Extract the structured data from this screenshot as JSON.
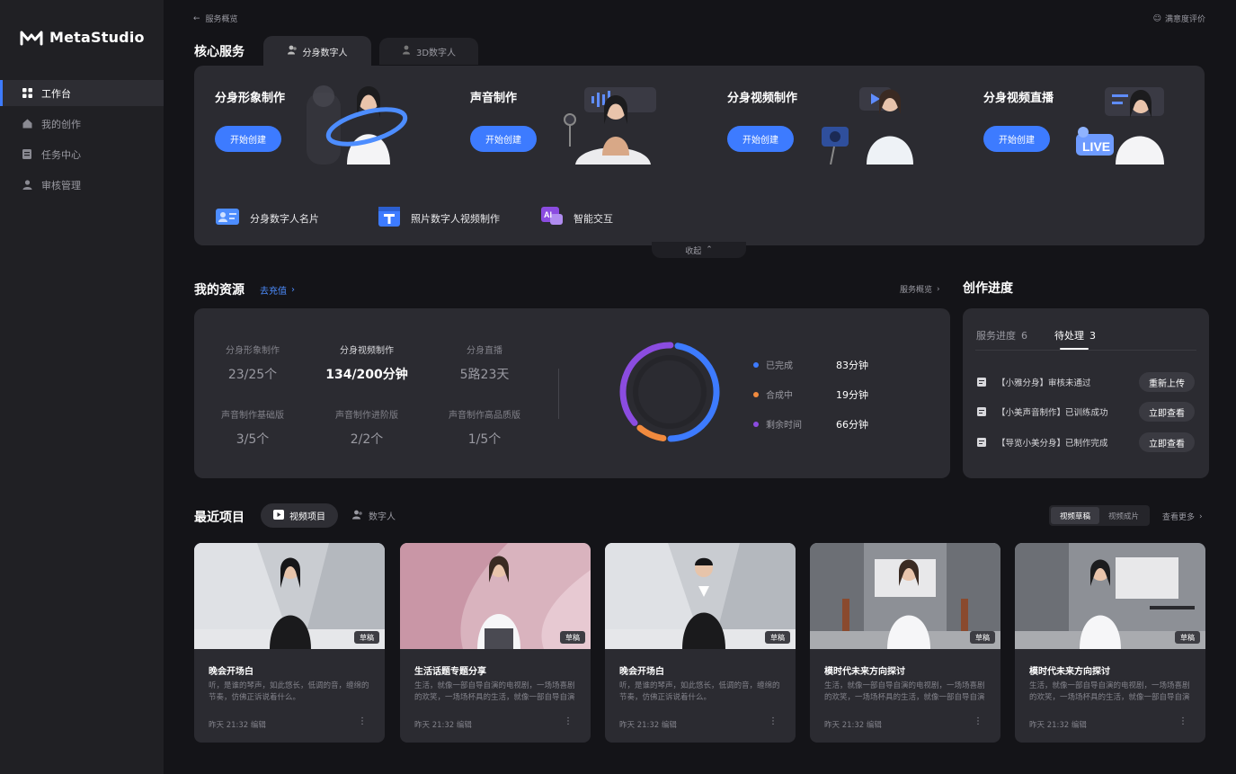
{
  "app": {
    "name": "MetaStudio"
  },
  "sidebar": {
    "items": [
      {
        "label": "工作台",
        "icon": "grid-icon",
        "active": true
      },
      {
        "label": "我的创作",
        "icon": "home-icon"
      },
      {
        "label": "任务中心",
        "icon": "task-icon"
      },
      {
        "label": "审核管理",
        "icon": "user-icon"
      }
    ]
  },
  "topbar": {
    "back_label": "服务概览",
    "feedback_label": "满意度评价"
  },
  "core": {
    "title": "核心服务",
    "tabs": [
      {
        "label": "分身数字人",
        "icon": "avatar-icon"
      },
      {
        "label": "3D数字人",
        "icon": "3d-avatar-icon"
      }
    ],
    "services": [
      {
        "title": "分身形象制作",
        "button": "开始创建"
      },
      {
        "title": "声音制作",
        "button": "开始创建"
      },
      {
        "title": "分身视频制作",
        "button": "开始创建"
      },
      {
        "title": "分身视频直播",
        "button": "开始创建"
      }
    ],
    "live_badge": "LIVE",
    "quick_links": [
      {
        "label": "分身数字人名片",
        "icon": "card-icon"
      },
      {
        "label": "照片数字人视频制作",
        "icon": "photo-video-icon"
      },
      {
        "label": "智能交互",
        "icon": "ai-chat-icon",
        "icon_text": "AI"
      }
    ],
    "collapse_label": "收起"
  },
  "resources": {
    "title": "我的资源",
    "recharge_label": "去充值",
    "overview_label": "服务概览",
    "items": [
      {
        "label": "分身形象制作",
        "value": "23/25个"
      },
      {
        "label": "分身视频制作",
        "value": "134/200分钟"
      },
      {
        "label": "分身直播",
        "value": "5路23天"
      },
      {
        "label": "声音制作基础版",
        "value": "3/5个"
      },
      {
        "label": "声音制作进阶版",
        "value": "2/2个"
      },
      {
        "label": "声音制作高品质版",
        "value": "1/5个"
      }
    ],
    "usage": [
      {
        "label": "已完成",
        "value": "83分钟",
        "minutes": 83,
        "color": "#3d7bff"
      },
      {
        "label": "合成中",
        "value": "19分钟",
        "minutes": 19,
        "color": "#f08a3e"
      },
      {
        "label": "剩余时间",
        "value": "66分钟",
        "minutes": 66,
        "color": "#8b4ce0"
      }
    ]
  },
  "progress": {
    "title": "创作进度",
    "tabs": [
      {
        "label": "服务进度",
        "count": "6"
      },
      {
        "label": "待处理",
        "count": "3",
        "active": true
      }
    ],
    "tasks": [
      {
        "text": "【小雅分身】审核未通过",
        "button": "重新上传"
      },
      {
        "text": "【小美声音制作】已训练成功",
        "button": "立即查看"
      },
      {
        "text": "【导览小美分身】已制作完成",
        "button": "立即查看"
      }
    ]
  },
  "recent": {
    "title": "最近项目",
    "tabs": [
      {
        "label": "视频项目",
        "icon": "video-icon"
      },
      {
        "label": "数字人",
        "icon": "avatar-icon"
      }
    ],
    "toggle": [
      "视频草稿",
      "视频成片"
    ],
    "more_label": "查看更多",
    "cards": [
      {
        "title": "晚会开场白",
        "desc": "听，是谁的琴声，如此悠长，低调的音，缠绵的节奏，仿佛正诉说着什么。",
        "time": "昨天 21:32 编辑",
        "badge": "草稿"
      },
      {
        "title": "生活话题专题分享",
        "desc": "生活，就像一部自导自演的电视剧，一场场喜剧的欢笑，一场场杯具的生活，就像一部自导自演的电视剧。",
        "time": "昨天 21:32 编辑",
        "badge": "草稿"
      },
      {
        "title": "晚会开场白",
        "desc": "听，是谁的琴声，如此悠长，低调的音，缠绵的节奏，仿佛正诉说着什么。",
        "time": "昨天 21:32 编辑",
        "badge": "草稿"
      },
      {
        "title": "模时代未来方向探讨",
        "desc": "生活，就像一部自导自演的电视剧，一场场喜剧的欢笑，一场场杯具的生活，就像一部自导自演的电视剧。",
        "time": "昨天 21:32 编辑",
        "badge": "草稿"
      },
      {
        "title": "模时代未来方向探讨",
        "desc": "生活，就像一部自导自演的电视剧，一场场喜剧的欢笑，一场场杯具的生活，就像一部自导自演的电视剧。",
        "time": "昨天 21:32 编辑",
        "badge": "草稿"
      }
    ]
  }
}
